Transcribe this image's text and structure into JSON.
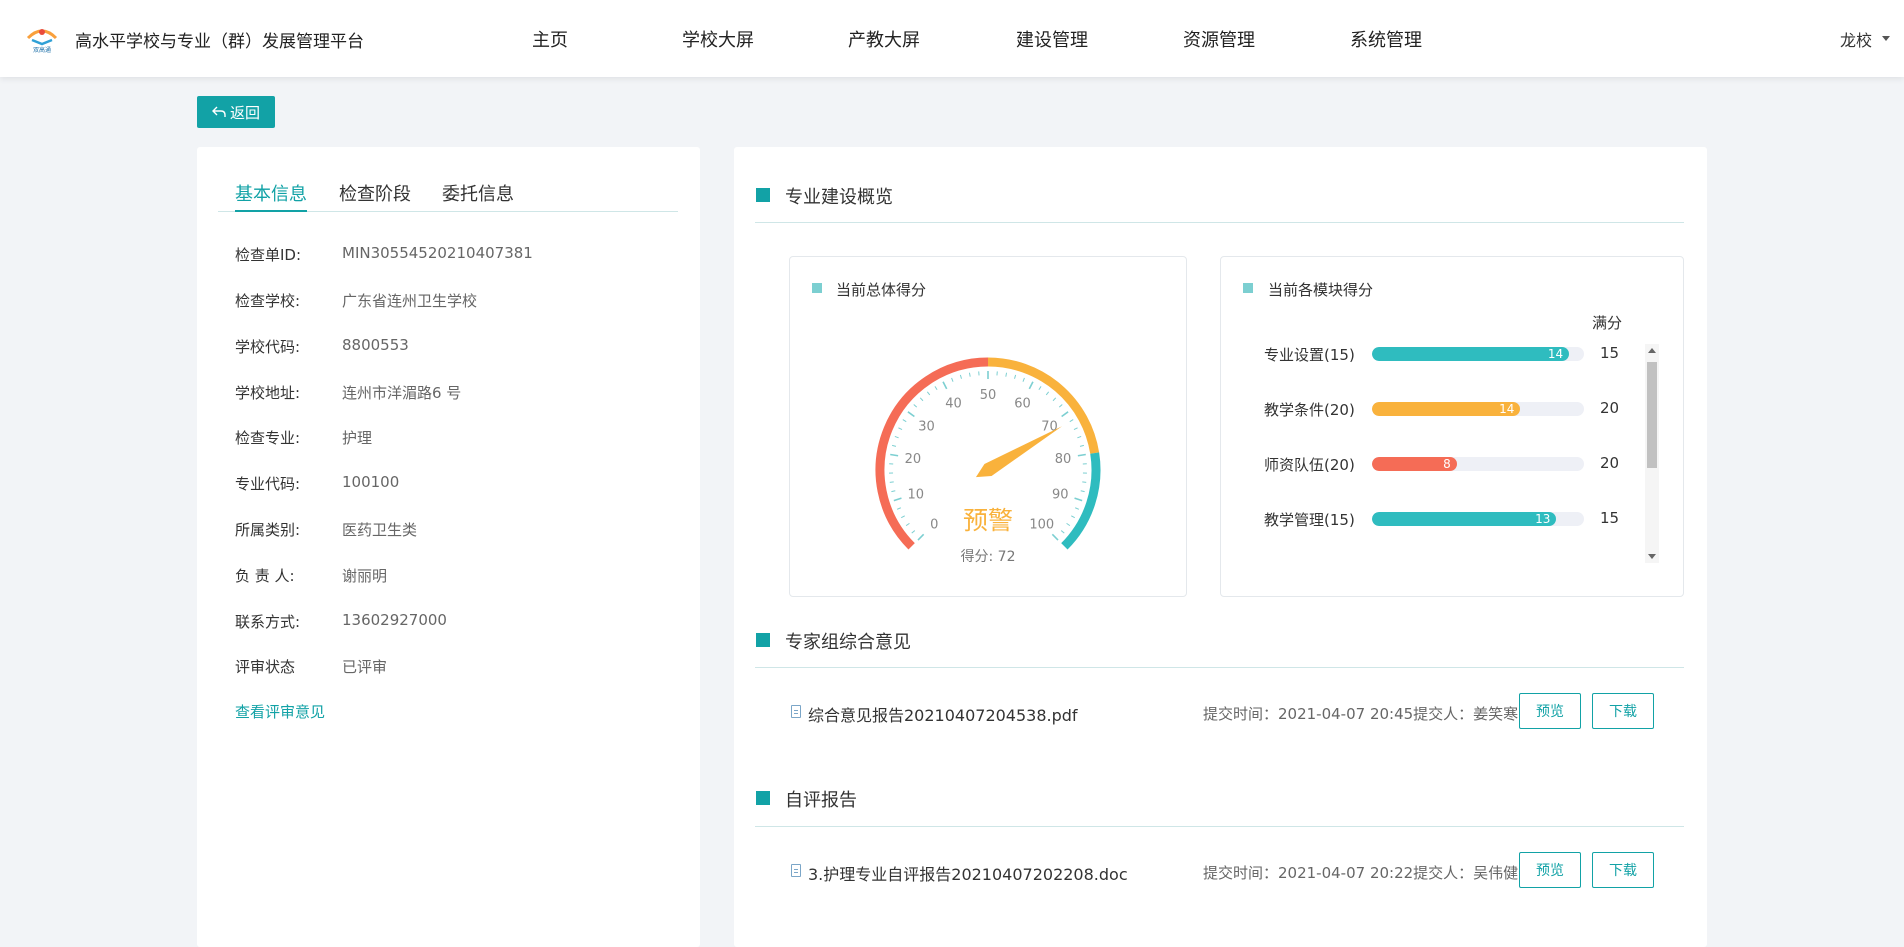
{
  "header": {
    "app_title": "高水平学校与专业（群）发展管理平台",
    "logo_text": "双高通",
    "nav": [
      "主页",
      "学校大屏",
      "产教大屏",
      "建设管理",
      "资源管理",
      "系统管理"
    ],
    "user": "龙校"
  },
  "back_label": "返回",
  "tabs": [
    "基本信息",
    "检查阶段",
    "委托信息"
  ],
  "info": [
    {
      "label": "检查单ID:",
      "value": "MIN30554520210407381"
    },
    {
      "label": "检查学校:",
      "value": "广东省连州卫生学校"
    },
    {
      "label": "学校代码:",
      "value": "8800553"
    },
    {
      "label": "学校地址:",
      "value": "连州市洋湄路6 号"
    },
    {
      "label": "检查专业:",
      "value": "护理"
    },
    {
      "label": "专业代码:",
      "value": "100100"
    },
    {
      "label": "所属类别:",
      "value": "医药卫生类"
    },
    {
      "label": "负 责 人:",
      "value": "谢丽明"
    },
    {
      "label": "联系方式:",
      "value": "13602927000"
    },
    {
      "label": "评审状态",
      "value": "已评审"
    }
  ],
  "view_review_link": "查看评审意见",
  "overview": {
    "title": "专业建设概览",
    "total": {
      "title": "当前总体得分",
      "status": "预警",
      "score_text": "得分: 72",
      "score": 72,
      "ticks": [
        "0",
        "10",
        "20",
        "30",
        "40",
        "50",
        "60",
        "70",
        "80",
        "90",
        "100"
      ],
      "colors": {
        "red": "#f56c56",
        "yellow": "#f9b23c",
        "teal": "#2fbcbf"
      }
    },
    "modules": {
      "title": "当前各模块得分",
      "full_label": "满分",
      "items": [
        {
          "label": "专业设置(15)",
          "score": "14",
          "max": "15",
          "ratio": 0.93,
          "color": "#2fbcbf"
        },
        {
          "label": "教学条件(20)",
          "score": "14",
          "max": "20",
          "ratio": 0.7,
          "color": "#f9b23c"
        },
        {
          "label": "师资队伍(20)",
          "score": "8",
          "max": "20",
          "ratio": 0.4,
          "color": "#f56c56"
        },
        {
          "label": "教学管理(15)",
          "score": "13",
          "max": "15",
          "ratio": 0.87,
          "color": "#2fbcbf"
        }
      ]
    }
  },
  "expert": {
    "title": "专家组综合意见",
    "file": "综合意见报告20210407204538.pdf",
    "meta": "提交时间：2021-04-07 20:45提交人：姜笑寒",
    "preview": "预览",
    "download": "下载"
  },
  "self_report": {
    "title": "自评报告",
    "file": "3.护理专业自评报告20210407202208.doc",
    "meta": "提交时间：2021-04-07 20:22提交人：吴伟健",
    "preview": "预览",
    "download": "下载"
  }
}
